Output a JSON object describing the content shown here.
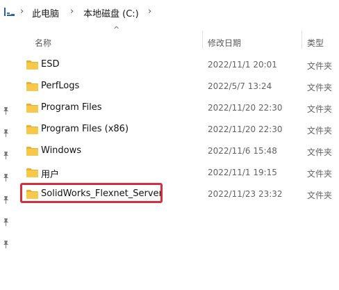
{
  "address_bar": {
    "breadcrumbs": [
      "此电脑",
      "本地磁盘 (C:)"
    ],
    "icon": "this-pc-icon"
  },
  "columns": {
    "name": "名称",
    "modified": "修改日期",
    "type": "类型"
  },
  "rows": [
    {
      "name": "ESD",
      "modified": "2022/11/1 20:01",
      "type": "文件夹"
    },
    {
      "name": "PerfLogs",
      "modified": "2022/5/7 13:24",
      "type": "文件夹"
    },
    {
      "name": "Program Files",
      "modified": "2022/11/20 22:30",
      "type": "文件夹"
    },
    {
      "name": "Program Files (x86)",
      "modified": "2022/11/20 22:30",
      "type": "文件夹"
    },
    {
      "name": "Windows",
      "modified": "2022/11/6 15:48",
      "type": "文件夹"
    },
    {
      "name": "用户",
      "modified": "2022/11/1 19:15",
      "type": "文件夹"
    },
    {
      "name": "SolidWorks_Flexnet_Server",
      "modified": "2022/11/23 23:32",
      "type": "文件夹",
      "highlighted": true
    }
  ],
  "colors": {
    "folder": "#f6c94a",
    "highlight": "#d32f3f"
  }
}
